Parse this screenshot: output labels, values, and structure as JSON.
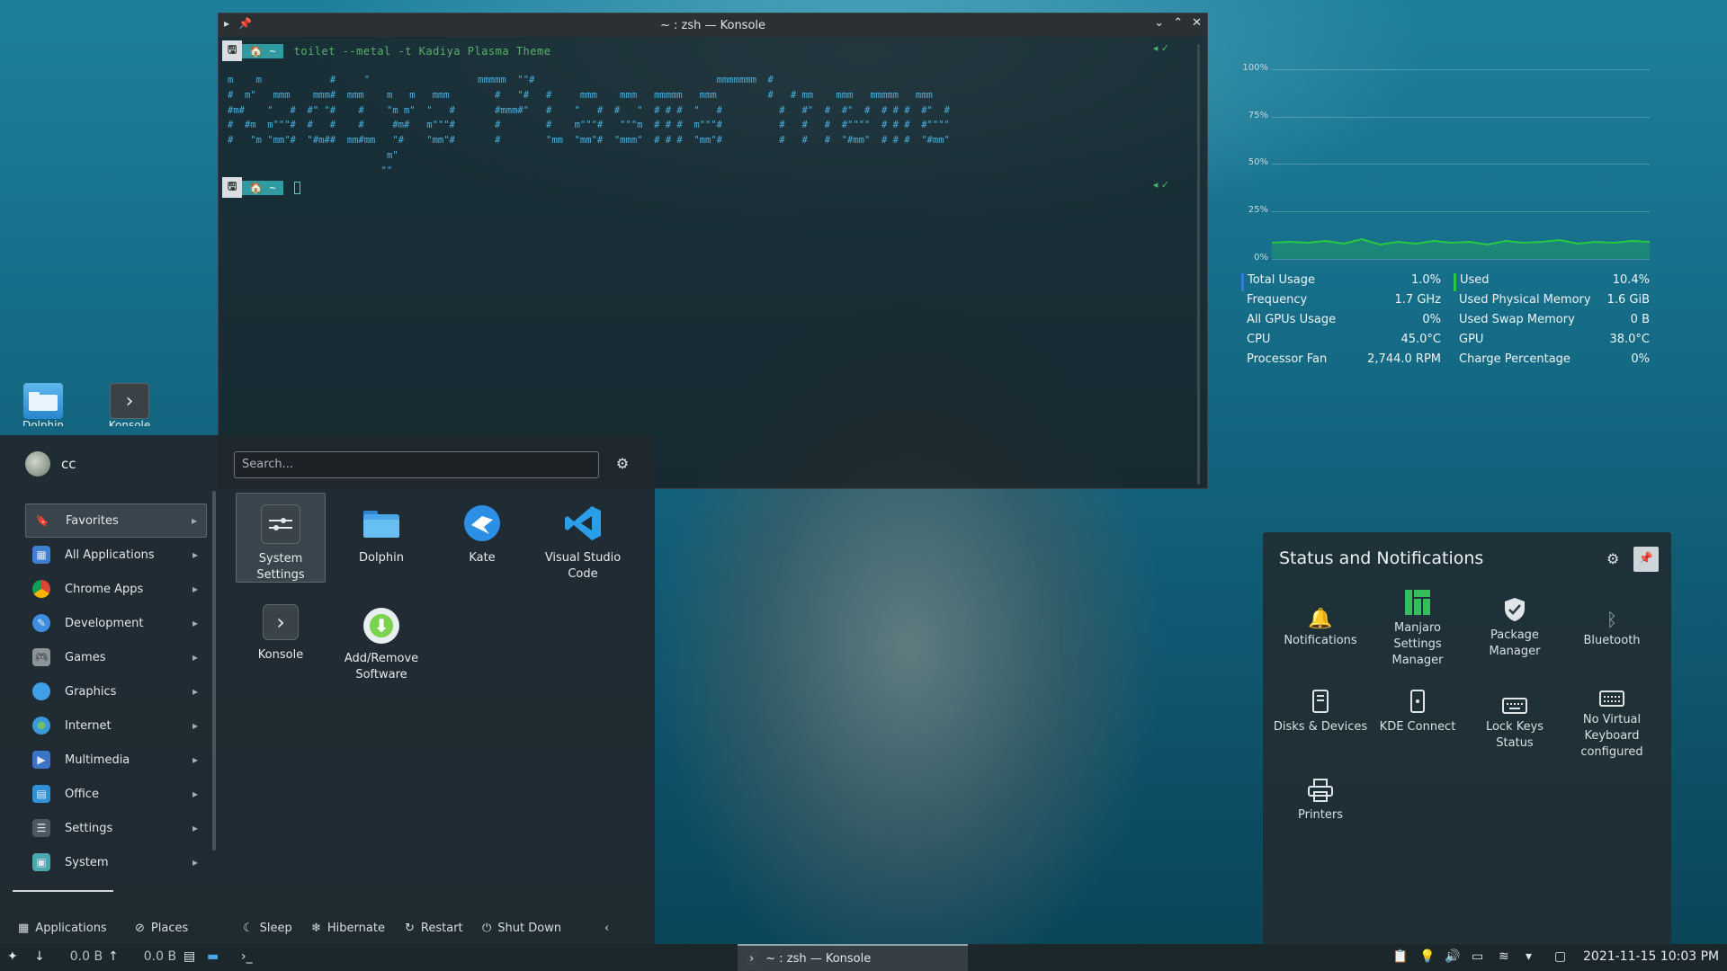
{
  "desktop": {
    "icons": [
      {
        "label": "Dolphin",
        "icon": "folder-icon"
      },
      {
        "label": "Konsole",
        "icon": "terminal-icon"
      }
    ]
  },
  "konsole": {
    "title": "~ : zsh — Konsole",
    "prompt1": {
      "seg1": "🖫",
      "seg2": "🏠 ~",
      "command": "toilet --metal -t  Kadiya Plasma Theme"
    },
    "prompt2": {
      "seg1": "🖫",
      "seg2": "🏠 ~"
    },
    "toilet_output": "m    m            #     \"                   mmmmm  \"\"#                                mmmmmmm  #\n#  m\"   mmm    mmm#  mmm    m   m   mmm        #   \"#   #     mmm    mmm   mmmmm   mmm         #   # mm    mmm   mmmmm   mmm\n#m#    \"   #  #\" \"#    #    \"m m\"  \"   #       #mmm#\"   #    \"   #  #   \"  # # #  \"   #          #   #\"  #  #\"  #  # # #  #\"  #\n#  #m  m\"\"\"#  #   #    #     #m#   m\"\"\"#       #        #    m\"\"\"#   \"\"\"m  # # #  m\"\"\"#          #   #   #  #\"\"\"\"  # # #  #\"\"\"\"\n#   \"m \"mm\"#  \"#m##  mm#mm   \"#    \"mm\"#       #        \"mm  \"mm\"#  \"mmm\"  # # #  \"mm\"#          #   #   #  \"#mm\"  # # #  \"#mm\"\n                            m\"\n                           \"\""
  },
  "launcher": {
    "user": "cc",
    "search_placeholder": "Search...",
    "categories": [
      {
        "label": "Favorites",
        "icon": "bookmark-icon",
        "color": "#3b4a52"
      },
      {
        "label": "All Applications",
        "icon": "grid-icon",
        "color": "#3d7fd0"
      },
      {
        "label": "Chrome Apps",
        "icon": "chrome-icon",
        "color": "#db4437"
      },
      {
        "label": "Development",
        "icon": "development-icon",
        "color": "#3d8ee0"
      },
      {
        "label": "Games",
        "icon": "gamepad-icon",
        "color": "#8a9499"
      },
      {
        "label": "Graphics",
        "icon": "graphics-icon",
        "color": "#3fa0e8"
      },
      {
        "label": "Internet",
        "icon": "globe-icon",
        "color": "#3a9ad9"
      },
      {
        "label": "Multimedia",
        "icon": "multimedia-icon",
        "color": "#3b73c7"
      },
      {
        "label": "Office",
        "icon": "office-icon",
        "color": "#2f8fd8"
      },
      {
        "label": "Settings",
        "icon": "settings-icon",
        "color": "#4b5a62"
      },
      {
        "label": "System",
        "icon": "system-icon",
        "color": "#4aa7b0"
      }
    ],
    "apps": [
      {
        "label": "System Settings",
        "icon": "system-settings-icon"
      },
      {
        "label": "Dolphin",
        "icon": "folder-icon"
      },
      {
        "label": "Kate",
        "icon": "kate-icon"
      },
      {
        "label": "Visual Studio Code",
        "icon": "vscode-icon"
      },
      {
        "label": "Konsole",
        "icon": "terminal-icon"
      },
      {
        "label": "Add/Remove Software",
        "icon": "download-icon"
      }
    ],
    "footer": {
      "applications": "Applications",
      "places": "Places",
      "sleep": "Sleep",
      "hibernate": "Hibernate",
      "restart": "Restart",
      "shutdown": "Shut Down"
    }
  },
  "sysmon": {
    "grid_labels": [
      "100%",
      "75%",
      "50%",
      "25%",
      "0%"
    ],
    "left": [
      {
        "label": "Total Usage",
        "value": "1.0%"
      },
      {
        "label": "Frequency",
        "value": "1.7 GHz"
      },
      {
        "label": "All GPUs Usage",
        "value": "0%"
      },
      {
        "label": "CPU",
        "value": "45.0°C"
      },
      {
        "label": "Processor Fan",
        "value": "2,744.0 RPM"
      }
    ],
    "right": [
      {
        "label": "Used",
        "value": "10.4%"
      },
      {
        "label": "Used Physical Memory",
        "value": "1.6 GiB"
      },
      {
        "label": "Used Swap Memory",
        "value": "0 B"
      },
      {
        "label": "GPU",
        "value": "38.0°C"
      },
      {
        "label": "Charge Percentage",
        "value": "0%"
      }
    ],
    "accent_blue": "#2f7fd8",
    "accent_green": "#27c93f"
  },
  "status": {
    "title": "Status and Notifications",
    "items": [
      {
        "label": "Notifications",
        "icon": "bell-icon"
      },
      {
        "label": "Manjaro Settings Manager",
        "icon": "manjaro-icon"
      },
      {
        "label": "Package Manager",
        "icon": "shield-icon"
      },
      {
        "label": "Bluetooth",
        "icon": "bluetooth-icon"
      },
      {
        "label": "Disks & Devices",
        "icon": "disk-icon"
      },
      {
        "label": "KDE Connect",
        "icon": "phone-icon"
      },
      {
        "label": "Lock Keys Status",
        "icon": "keyboard-icon"
      },
      {
        "label": "No Virtual Keyboard configured",
        "icon": "virtual-keyboard-icon"
      },
      {
        "label": "Printers",
        "icon": "printer-icon"
      }
    ]
  },
  "taskbar": {
    "net_down": "0.0 B",
    "net_up": "0.0 B",
    "task_label": "~ : zsh — Konsole",
    "clock": "2021-11-15  10:03 PM"
  }
}
